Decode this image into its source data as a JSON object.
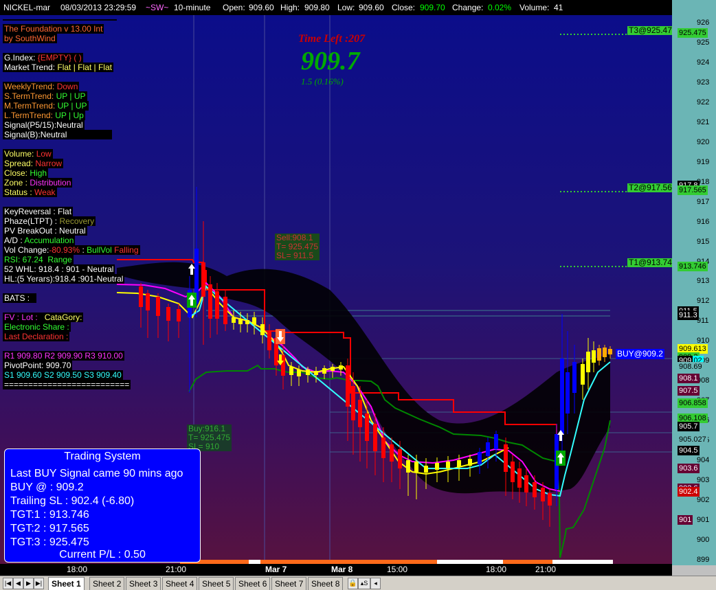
{
  "header": {
    "symbol": "NICKEL-mar",
    "datetime": "08/03/2013 23:29:59",
    "author": "~SW~",
    "interval": "10-minute",
    "open_label": "Open:",
    "open": "909.60",
    "high_label": "High:",
    "high": "909.80",
    "low_label": "Low:",
    "low": "909.60",
    "close_label": "Close:",
    "close": "909.70",
    "change_label": "Change:",
    "change": "0.02%",
    "volume_label": "Volume:",
    "volume": "41"
  },
  "info_panel": {
    "title": "The Foundation v 13.00 Int",
    "by": "by SouthWind",
    "gindex_label": "G.Index:",
    "gindex_value": "{EMPTY} ( )",
    "market_trend_label": "Market Trend:",
    "market_trend_value": "Flat | Flat | Flat",
    "weekly_label": "WeeklyTrend:",
    "weekly_value": "Down",
    "sterm_label": "S.TermTrend:",
    "sterm_value": "UP | UP",
    "mterm_label": "M.TermTrend:",
    "mterm_value": "UP | UP",
    "lterm_label": "L.TermTrend:",
    "lterm_value": "UP | Up",
    "signal_p": "Signal(P5/15):Neutral",
    "signal_b": "Signal(B):Neutral",
    "volume_label": "Volume:",
    "volume_value": "Low",
    "spread_label": "Spread:",
    "spread_value": "Narrow",
    "close_label": "Close:",
    "close_value": "High",
    "zone_label": "Zone :",
    "zone_value": "Distribution",
    "status_label": "Status :",
    "status_value": "Weak",
    "keyreversal": "KeyReversal : Flat",
    "phaze_label": "Phaze(LTPT) :",
    "phaze_value": "Recovery",
    "pv_breakout": "PV BreakOut : Neutral",
    "ad_label": "A/D :",
    "ad_value": "Accumulation",
    "volchange_label": "Vol Change:",
    "volchange_value": "-80.93%",
    "volchange_sep": ":",
    "bullvol": "BullVol",
    "falling": "Falling",
    "rsi": "RSI: 67.24",
    "rsi_state": "Range",
    "whl52": "52 WHL: 918.4 : 901 - Neutral",
    "hl5": "HL:(5 Yerars):918.4 :901-Neutral",
    "bats": "BATS :",
    "fv_label": "FV :",
    "lot_label": "Lot :",
    "category_label": "CataGory:",
    "electronic_share": "Electronic Share :",
    "last_declaration": "Last Declaration :",
    "resistance": "R1 909.80 R2 909.90 R3 910.00",
    "pivot": "PivotPoint: 909.70",
    "support": "S1 909.60 S2 909.50 S3 909.40",
    "separator": "=========================="
  },
  "chart_labels": {
    "time_left": "Time Left :207",
    "big_price": "909.7",
    "price_change": "1.5  (0.16%)",
    "sell_box": [
      "Sell:908.1",
      "T= 925.475",
      "SL= 911.5"
    ],
    "buy_box": [
      "Buy:916.1",
      "T= 925.475",
      "SL= 910"
    ],
    "buy_at": "BUY@909.2",
    "t3": "T3@925.47",
    "t2": "T2@917.56",
    "t1": "T1@913.74"
  },
  "trading_system": {
    "title": "Trading System",
    "last_signal": "Last BUY Signal came 90 mins ago",
    "buy": "BUY @  : 909.2",
    "trailing": "Trailing SL : 902.4 (-6.80)",
    "tgt1": "TGT:1 : 913.746",
    "tgt2": "TGT:2 : 917.565",
    "tgt3": "TGT:3 : 925.475",
    "pl": "Current P/L : 0.50"
  },
  "y_axis": {
    "ticks": [
      "926",
      "925",
      "924",
      "923",
      "922",
      "921",
      "920",
      "919",
      "918",
      "917",
      "916",
      "915",
      "914",
      "913",
      "912",
      "911",
      "910",
      "909",
      "908",
      "907",
      "906",
      "905",
      "904",
      "903",
      "902",
      "901",
      "900",
      "899"
    ],
    "badges": [
      {
        "text": "925.475",
        "bg": "#33cc33"
      },
      {
        "text": "917.8",
        "bg": "#000000"
      },
      {
        "text": "917.565",
        "bg": "#33cc33"
      },
      {
        "text": "913.746",
        "bg": "#33cc33"
      },
      {
        "text": "911.5",
        "bg": "#000000"
      },
      {
        "text": "911.3",
        "bg": "#000000"
      },
      {
        "text": "909.613",
        "bg": "#ffff00"
      },
      {
        "text": "909.2",
        "bg": "#33cc33"
      },
      {
        "text": "909.02",
        "bg": "#00ffff"
      },
      {
        "text": "909",
        "bg": "#000000"
      },
      {
        "text": "908.69",
        "bg": "#6bb5b5"
      },
      {
        "text": "908.1",
        "bg": "#660033"
      },
      {
        "text": "907.5",
        "bg": "#660033"
      },
      {
        "text": "906.858",
        "bg": "#33cc33"
      },
      {
        "text": "906.108",
        "bg": "#33cc33"
      },
      {
        "text": "905.7",
        "bg": "#000000"
      },
      {
        "text": "905.027",
        "bg": "#6bb5b5"
      },
      {
        "text": "904.5",
        "bg": "#000000"
      },
      {
        "text": "903.6",
        "bg": "#660033"
      },
      {
        "text": "902.6",
        "bg": "#660033"
      },
      {
        "text": "902.4",
        "bg": "#cc0000"
      },
      {
        "text": "901",
        "bg": "#660033"
      }
    ]
  },
  "x_axis": {
    "ticks": [
      "18:00",
      "21:00",
      "Mar 7",
      "Mar 8",
      "15:00",
      "18:00",
      "21:00"
    ]
  },
  "sheets": {
    "tabs": [
      "Sheet 1",
      "Sheet 2",
      "Sheet 3",
      "Sheet 4",
      "Sheet 5",
      "Sheet 6",
      "Sheet 7",
      "Sheet 8"
    ],
    "active": "Sheet 1",
    "nav_icons": [
      "first-icon",
      "prev-icon",
      "next-icon",
      "last-icon"
    ]
  },
  "colors": {
    "background_top": "#0b0d8a",
    "background_bottom": "#571240",
    "bull_candle": "#0000ff",
    "bear_candle": "#ff0000",
    "neutral_candle": "#ffff00",
    "stop_line": "#ff0000",
    "support_line": "#008800",
    "axis_panel": "#6bb5b5"
  }
}
